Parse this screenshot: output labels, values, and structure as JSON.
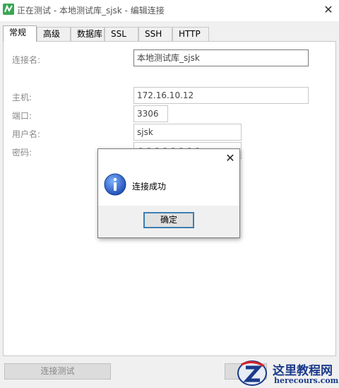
{
  "window": {
    "title": "正在测试 - 本地测试库_sjsk - 编辑连接",
    "close_glyph": "✕",
    "app_icon": "navicat-icon"
  },
  "tabs": [
    {
      "label": "常规",
      "active": true
    },
    {
      "label": "高级",
      "active": false
    },
    {
      "label": "数据库",
      "active": false
    },
    {
      "label": "SSL",
      "active": false
    },
    {
      "label": "SSH",
      "active": false
    },
    {
      "label": "HTTP",
      "active": false
    }
  ],
  "form": {
    "connection_name": {
      "label": "连接名:",
      "value": "本地测试库_sjsk"
    },
    "host": {
      "label": "主机:",
      "value": "172.16.10.12"
    },
    "port": {
      "label": "端口:",
      "value": "3306"
    },
    "username": {
      "label": "用户名:",
      "value": "sjsk"
    },
    "password": {
      "label": "密码:",
      "value": "●●●●●●●●"
    }
  },
  "buttons": {
    "test_connection": "连接测试"
  },
  "dialog": {
    "close_glyph": "✕",
    "icon": "info-icon",
    "message": "连接成功",
    "ok_label": "确定"
  },
  "watermark": {
    "cn_text": "这里教程网",
    "en_text": "herecours.com"
  },
  "colors": {
    "accent": "#3c7fb1",
    "info_icon_blue": "#2a62c9",
    "app_icon_green": "#3aa655",
    "watermark_blue": "#1a3a8a",
    "watermark_red": "#d4222a"
  }
}
